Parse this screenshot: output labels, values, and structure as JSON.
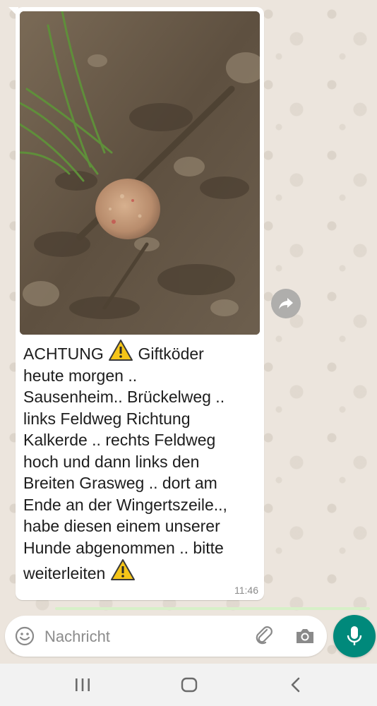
{
  "message": {
    "lines": [
      {
        "text": "ACHTUNG ",
        "warn_after": true,
        "after_text": " Giftköder"
      },
      {
        "text": "heute morgen .."
      },
      {
        "text": "Sausenheim.. Brückelweg .."
      },
      {
        "text": "links Feldweg Richtung"
      },
      {
        "text": "Kalkerde .. rechts Feldweg"
      },
      {
        "text": "hoch und dann links den"
      },
      {
        "text": "Breiten Grasweg .. dort am"
      },
      {
        "text": "Ende an der Wingertszeile..,"
      },
      {
        "text": "habe diesen einem unserer"
      },
      {
        "text": "Hunde abgenommen .. bitte"
      },
      {
        "text": "weiterleiten ",
        "warn_after": true
      }
    ],
    "time": "11:46"
  },
  "input": {
    "placeholder": "Nachricht"
  },
  "icons": {
    "forward": "forward-icon",
    "emoji": "emoji-icon",
    "attach": "paperclip-icon",
    "camera": "camera-icon",
    "mic": "microphone-icon",
    "warning": "warning-icon",
    "nav_recents": "recents-icon",
    "nav_home": "home-icon",
    "nav_back": "back-icon"
  },
  "colors": {
    "chat_background": "#ece5dd",
    "bubble": "#ffffff",
    "accent": "#00897b",
    "warning_fill": "#f5c518"
  }
}
